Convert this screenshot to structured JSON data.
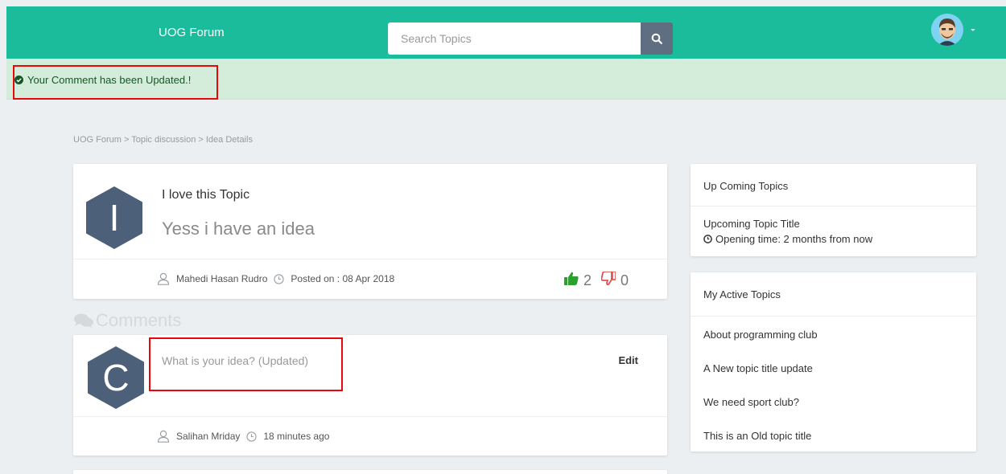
{
  "header": {
    "brand": "UOG Forum",
    "search_placeholder": "Search Topics"
  },
  "alert": {
    "message": "Your Comment has been Updated.!"
  },
  "breadcrumb": "UOG Forum > Topic discussion > Idea Details",
  "post": {
    "avatar_letter": "I",
    "title": "I love this Topic",
    "idea": "Yess i have an idea",
    "author": "Mahedi Hasan Rudro",
    "posted_on": "Posted on : 08 Apr 2018",
    "upvotes": "2",
    "downvotes": "0"
  },
  "comments": {
    "heading": "Comments",
    "items": [
      {
        "avatar_letter": "C",
        "text": "What is your idea? (Updated)",
        "edit_label": "Edit",
        "author": "Salihan Mriday",
        "time": "18 minutes ago"
      }
    ]
  },
  "sidebar": {
    "upcoming": {
      "heading": "Up Coming Topics",
      "title": "Upcoming Topic Title",
      "opening": "Opening time: 2 months from now"
    },
    "active": {
      "heading": "My Active Topics",
      "items": [
        "About programming club",
        "A New topic title update",
        "We need sport club?",
        "This is an Old topic title"
      ]
    }
  },
  "colors": {
    "topbar": "#1abc9c",
    "alert_bg": "#d4edda",
    "alert_text": "#155724",
    "avatar_hex": "#4d6079",
    "highlight": "#e8070b",
    "upvote": "#2ca02c",
    "downvote": "#d9534f"
  },
  "icons": [
    "search-icon",
    "user-avatar",
    "check-circle-icon",
    "user-icon",
    "clock-icon",
    "thumbs-up-icon",
    "thumbs-down-icon",
    "comments-icon"
  ]
}
